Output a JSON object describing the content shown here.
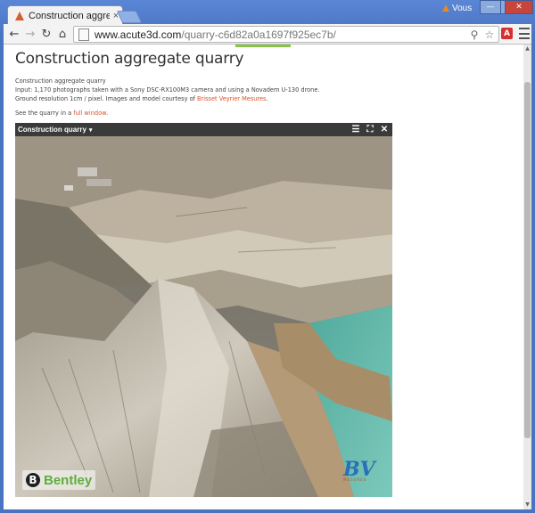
{
  "browser": {
    "tab_title": "Construction aggregate q",
    "tab_close": "×",
    "user_label": "Vous",
    "url_host": "www.acute3d.com",
    "url_path": "/quarry-c6d82a0a1697f925ec7b/",
    "window_controls": {
      "minimize": "—",
      "maximize": "□",
      "close": "✕"
    },
    "nav": {
      "back": "←",
      "forward": "→",
      "reload": "↻",
      "home": "⌂"
    },
    "extension_label": "A"
  },
  "page": {
    "title": "Construction aggregate quarry",
    "desc_line1": "Construction aggregate quarry",
    "desc_line2": "Input: 1,170 photographs taken with a Sony DSC-RX100M3 camera and using a Novadem U-130 drone.",
    "desc_line3_prefix": "Ground resolution 1cm / pixel. Images and model courtesy of ",
    "desc_link": "Brisset Veyrier Mesures",
    "desc_line3_suffix": ".",
    "see_prefix": "See the quarry in a ",
    "see_link": "full window",
    "see_suffix": "."
  },
  "viewer": {
    "title": "Construction quarry",
    "caret": "▾",
    "icons": [
      "menu-icon",
      "fullscreen-icon",
      "close-icon"
    ],
    "icon_glyphs": {
      "menu": "☰",
      "fullscreen": "⛶",
      "close": "✕"
    },
    "logo_bentley_mark": "B",
    "logo_bentley_text": "Bentley",
    "logo_bv_text": "BV",
    "logo_bv_sub": "MESURES"
  },
  "colors": {
    "link": "#d9532c",
    "viewer_bar": "#3a3a3a",
    "bentley_green": "#5fae3a",
    "water": "#5fb8a6"
  }
}
